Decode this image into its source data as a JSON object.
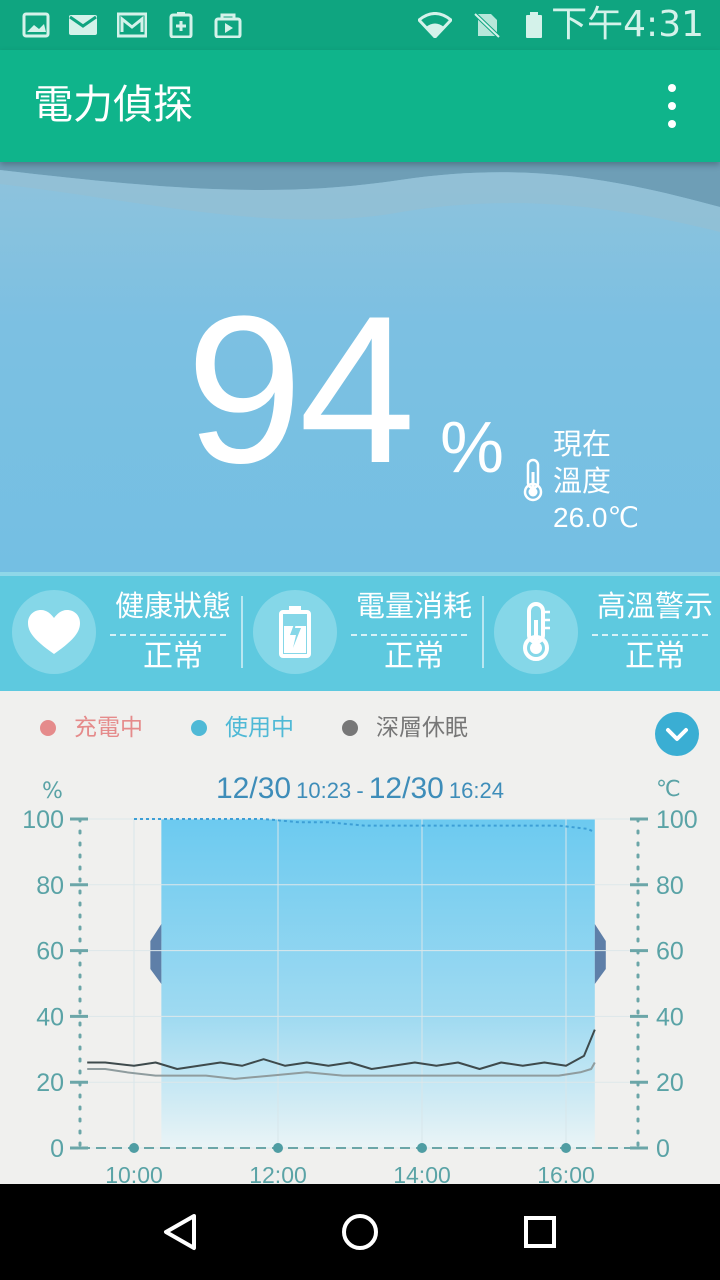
{
  "status_bar": {
    "time": "下午4:31",
    "left_icons": [
      "image-notification-icon",
      "mail-notification-icon",
      "gmail-notification-icon",
      "battery-app-notification-icon",
      "play-store-notification-icon"
    ],
    "right_icons": [
      "wifi-icon",
      "no-sim-icon",
      "battery-icon"
    ]
  },
  "app_bar": {
    "title": "電力偵探",
    "menu_icon": "more-vert-icon"
  },
  "battery": {
    "percent": "94",
    "percent_sign": "%",
    "temp_label_line1": "現在",
    "temp_label_line2": "溫度",
    "temperature": "26.0℃"
  },
  "status_cards": [
    {
      "icon": "heart-icon",
      "label": "健康狀態",
      "value": "正常"
    },
    {
      "icon": "battery-charge-icon",
      "label": "電量消耗",
      "value": "正常"
    },
    {
      "icon": "thermometer-icon",
      "label": "高溫警示",
      "value": "正常"
    }
  ],
  "legend": [
    {
      "label": "充電中",
      "color": "#e58b8b"
    },
    {
      "label": "使用中",
      "color": "#4fb9d6"
    },
    {
      "label": "深層休眠",
      "color": "#777777"
    }
  ],
  "range": {
    "start_date": "12/30",
    "start_time": "10:23",
    "separator": "-",
    "end_date": "12/30",
    "end_time": "16:24"
  },
  "chart_data": {
    "type": "line",
    "y_label_left": "%",
    "y_label_right": "℃",
    "ylim": [
      0,
      100
    ],
    "y_ticks": [
      "0",
      "20",
      "40",
      "60",
      "80",
      "100"
    ],
    "x_ticks": [
      "10:00",
      "12:00",
      "14:00",
      "16:00"
    ],
    "x_range_hours": [
      9.25,
      17.0
    ],
    "in_use_period": [
      10.38,
      16.4
    ],
    "series": [
      {
        "values_x": [
          10.0,
          10.4,
          11.0,
          11.3,
          11.8,
          12.3,
          12.7,
          13.2,
          13.7,
          14.3,
          14.8,
          15.4,
          15.9,
          16.3,
          16.4
        ],
        "values": [
          100,
          100,
          100,
          100,
          100,
          99,
          99,
          98,
          98,
          98,
          98,
          98,
          98,
          97,
          96
        ]
      },
      {
        "values_x": [
          9.35,
          9.6,
          10.0,
          10.3,
          10.6,
          10.9,
          11.2,
          11.5,
          11.8,
          12.1,
          12.4,
          12.7,
          13.0,
          13.3,
          13.6,
          13.9,
          14.2,
          14.5,
          14.8,
          15.1,
          15.4,
          15.7,
          16.0,
          16.25,
          16.4
        ],
        "values": [
          26,
          26,
          25,
          26,
          24,
          25,
          26,
          25,
          27,
          25,
          26,
          25,
          26,
          24,
          25,
          26,
          25,
          26,
          24,
          26,
          25,
          26,
          25,
          28,
          36
        ]
      },
      {
        "values_x": [
          9.35,
          9.6,
          9.9,
          10.3,
          11.0,
          11.4,
          11.9,
          12.4,
          12.9,
          13.4,
          13.9,
          14.4,
          14.9,
          15.4,
          15.9,
          16.2,
          16.35,
          16.4
        ],
        "values": [
          24,
          24,
          23,
          22,
          22,
          21,
          22,
          23,
          22,
          22,
          22,
          22,
          22,
          22,
          22,
          23,
          24,
          26
        ]
      }
    ]
  }
}
